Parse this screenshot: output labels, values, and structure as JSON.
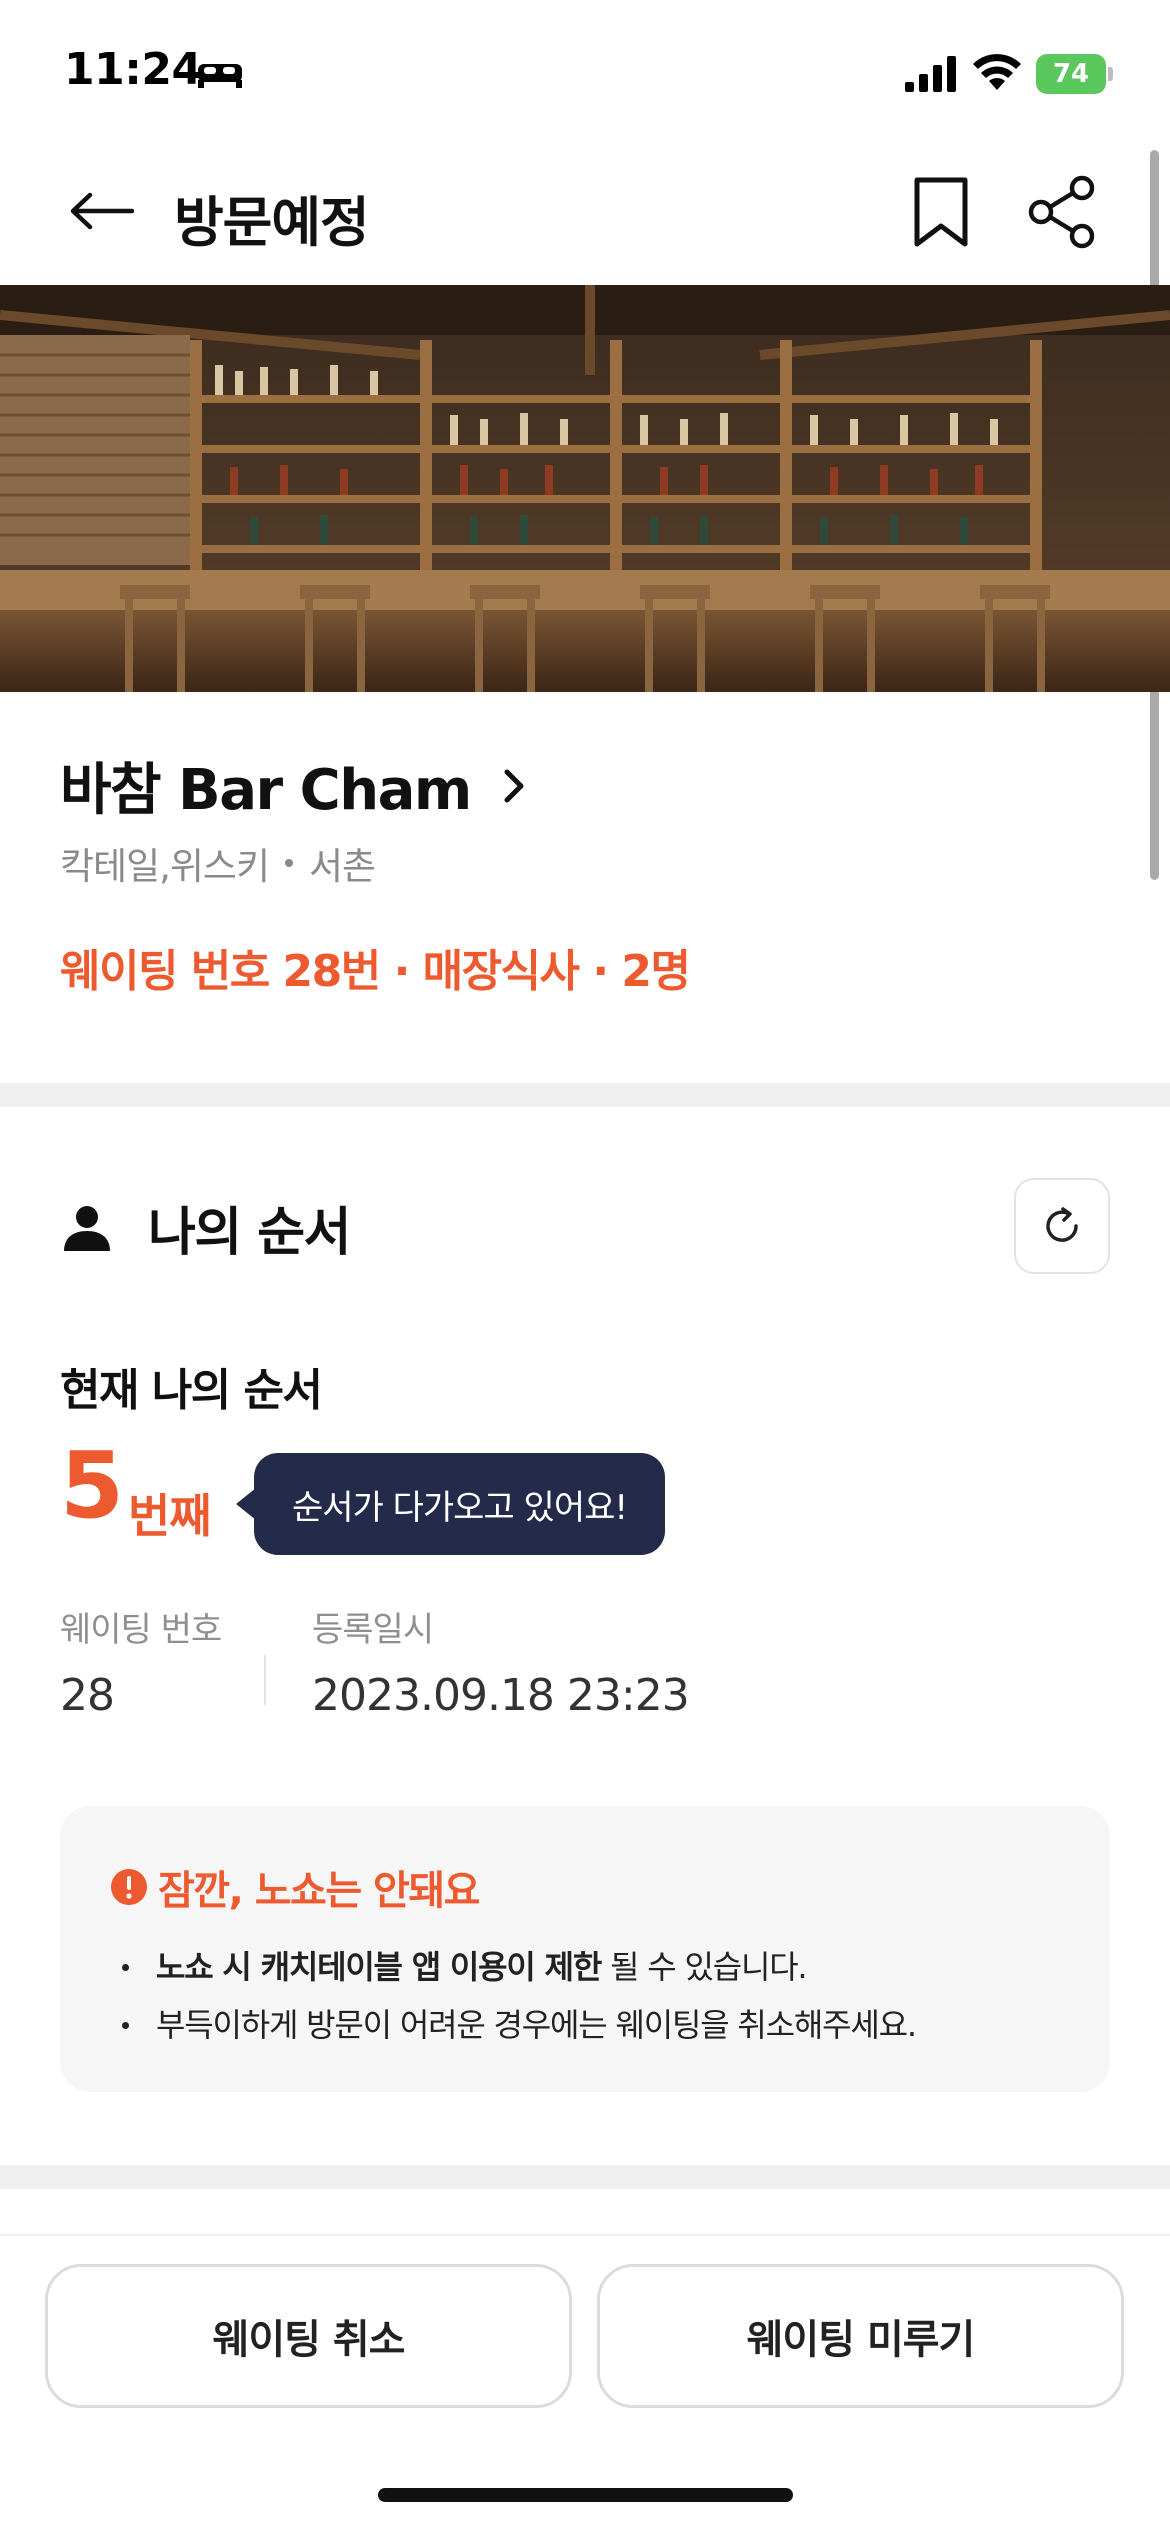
{
  "status_bar": {
    "time": "11:24",
    "battery": "74"
  },
  "header": {
    "title": "방문예정"
  },
  "store": {
    "name": "바참 Bar Cham",
    "category": "칵테일,위스키",
    "area": "서촌",
    "waiting_summary": "웨이팅 번호 28번 · 매장식사 · 2명"
  },
  "my_order": {
    "section_title": "나의 순서",
    "current_label": "현재 나의 순서",
    "position": "5",
    "position_suffix": "번째",
    "tooltip": "순서가 다가오고 있어요!",
    "waiting_number_label": "웨이팅 번호",
    "waiting_number": "28",
    "registered_label": "등록일시",
    "registered_at": "2023.09.18 23:23"
  },
  "notice": {
    "title": "잠깐, 노쇼는 안돼요",
    "item1_bold": "노쇼 시 캐치테이블 앱 이용이 제한",
    "item1_rest": " 될 수 있습니다.",
    "item2": "부득이하게 방문이 어려운 경우에는 웨이팅을 취소해주세요."
  },
  "actions": {
    "cancel_label": "웨이팅 취소",
    "postpone_label": "웨이팅 미루기"
  },
  "icons": {
    "back": "arrow-left-icon",
    "bookmark": "bookmark-icon",
    "share": "share-icon",
    "person": "person-icon",
    "refresh": "refresh-icon",
    "warning": "info-circle-icon"
  },
  "colors": {
    "accent": "#ee5a2f",
    "tooltip_bg": "#232a4a",
    "battery": "#5ac85d"
  }
}
